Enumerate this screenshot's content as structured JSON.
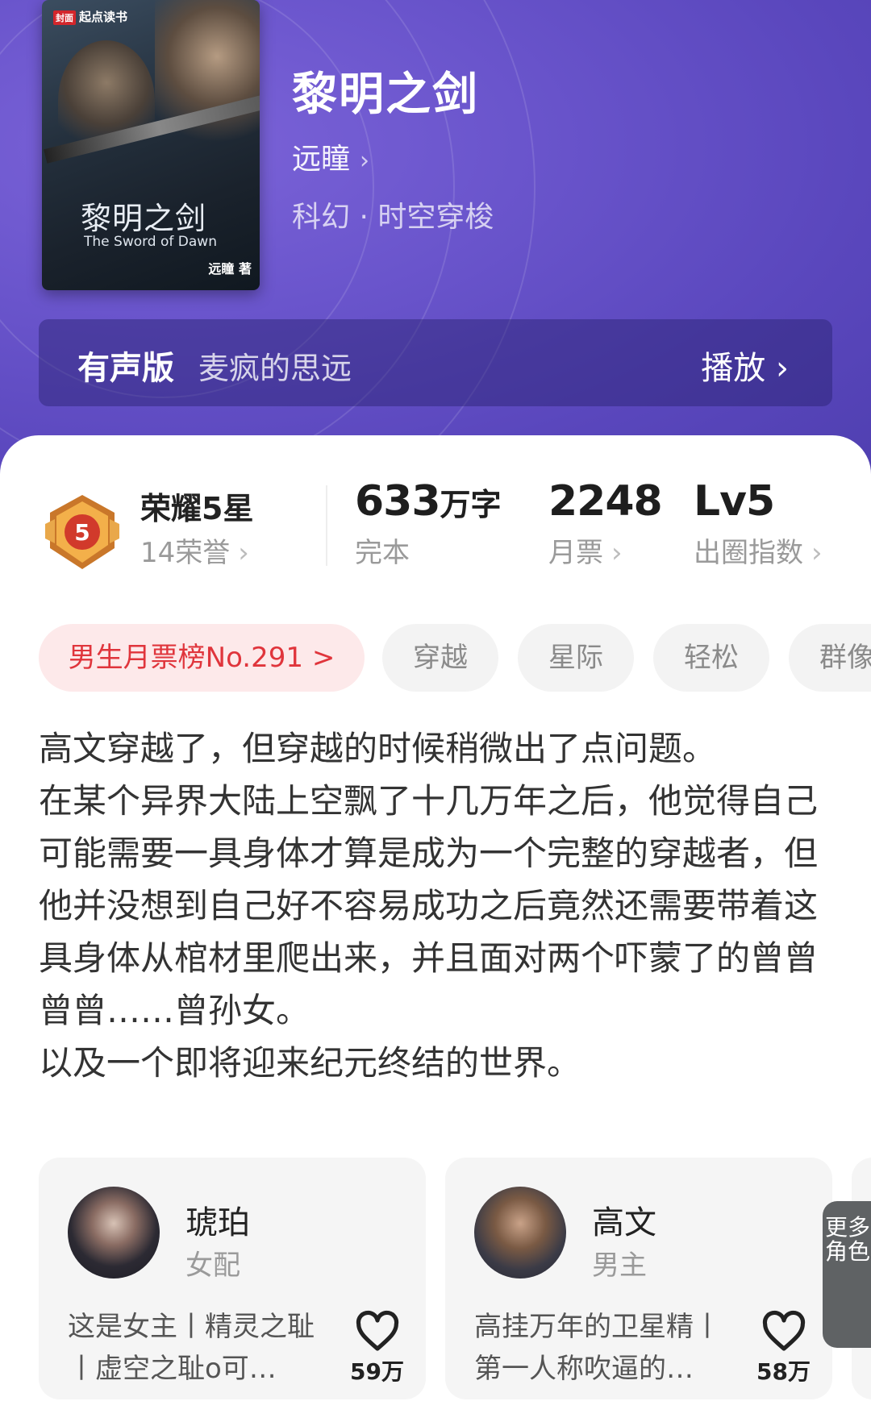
{
  "cover": {
    "publisher": "起点读书",
    "publisher_badge": "封面",
    "title_cn": "黎明之剑",
    "title_en": "The Sword of Dawn",
    "author_mark": "远瞳 著"
  },
  "book": {
    "title": "黎明之剑",
    "author": "远瞳",
    "genre": "科幻 · 时空穿梭"
  },
  "audio": {
    "label": "有声版",
    "narrator": "麦疯的思远",
    "play": "播放"
  },
  "honor": {
    "level_badge": "5",
    "title": "荣耀5星",
    "sub": "14荣誉"
  },
  "stats": [
    {
      "value": "633",
      "unit": "万字",
      "label": "完本",
      "chevron": false
    },
    {
      "value": "2248",
      "unit": "",
      "label": "月票",
      "chevron": true
    },
    {
      "value": "Lv5",
      "unit": "",
      "label": "出圈指数",
      "chevron": true
    }
  ],
  "tags": {
    "rank": "男生月票榜No.291 >",
    "items": [
      "穿越",
      "星际",
      "轻松",
      "群像"
    ]
  },
  "synopsis": [
    "高文穿越了，但穿越的时候稍微出了点问题。",
    "在某个异界大陆上空飘了十几万年之后，他觉得自己可能需要一具身体才算是成为一个完整的穿越者，但他并没想到自己好不容易成功之后竟然还需要带着这具身体从棺材里爬出来，并且面对两个吓蒙了的曾曾曾曾……曾孙女。",
    "以及一个即将迎来纪元终结的世界。"
  ],
  "characters": [
    {
      "name": "琥珀",
      "role": "女配",
      "desc": "这是女主丨精灵之耻丨虚空之耻o可…",
      "likes": "59万"
    },
    {
      "name": "高文",
      "role": "男主",
      "desc": "高挂万年的卫星精丨第一人称吹逼的…",
      "likes": "58万"
    }
  ],
  "more_roles": "更多角色",
  "colors": {
    "accent_red": "#e0353c",
    "hero_purple": "#6a55cc"
  }
}
